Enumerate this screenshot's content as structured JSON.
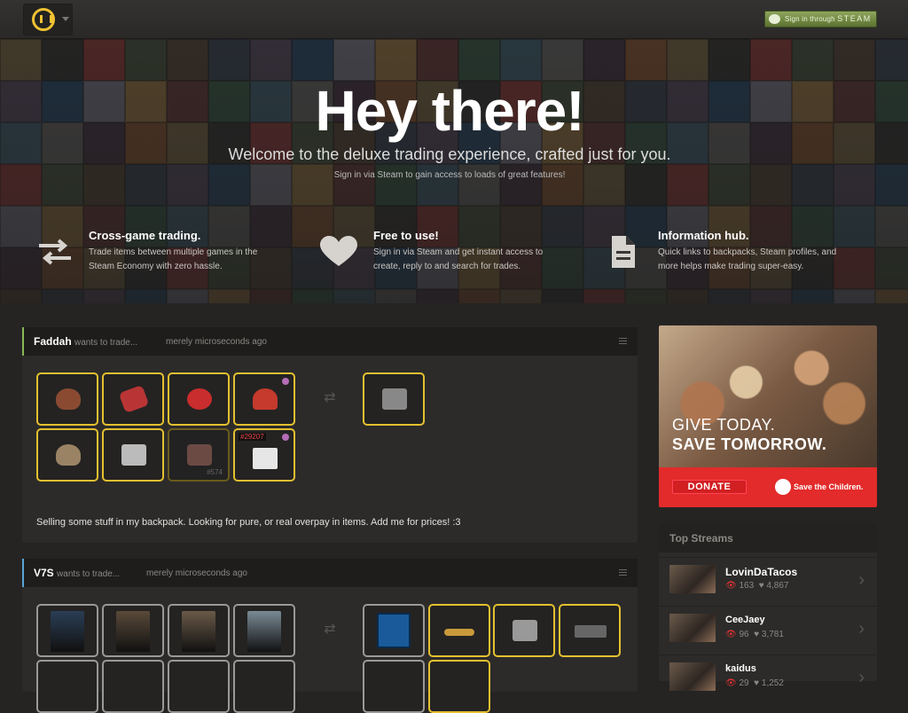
{
  "header": {
    "logo": "backpack-logo",
    "steam_signin_prefix": "Sign in through ",
    "steam_signin_word": "STEAM"
  },
  "hero": {
    "title": "Hey there!",
    "subtitle": "Welcome to the deluxe trading experience, crafted just for you.",
    "note": "Sign in via Steam to gain access to loads of great features!",
    "features": [
      {
        "icon": "exchange-arrows-icon",
        "title": "Cross-game trading.",
        "desc": "Trade items between multiple games in the Steam Economy with zero hassle."
      },
      {
        "icon": "heart-icon",
        "title": "Free to use!",
        "desc": "Sign in via Steam and get instant access to create, reply to and search for trades."
      },
      {
        "icon": "document-icon",
        "title": "Information hub.",
        "desc": "Quick links to backpacks, Steam profiles, and more helps make trading super-easy."
      }
    ]
  },
  "trades": [
    {
      "user": "Faddah",
      "wants": "wants to trade...",
      "time": "merely microseconds ago",
      "tags": [
        "#29207",
        "#574"
      ],
      "note": "Selling some stuff in my backpack. Looking for pure, or real overpay in items. Add me for prices! :3"
    },
    {
      "user": "V7S",
      "wants": "wants to trade...",
      "time": "merely microseconds ago"
    }
  ],
  "ad": {
    "line1": "GIVE TODAY.",
    "line2": "SAVE TOMORROW.",
    "donate": "DONATE",
    "org": "Save the Children."
  },
  "streams": {
    "title": "Top Streams",
    "items": [
      {
        "name": "LovinDaTacos",
        "viewers": "163",
        "followers": "4,867"
      },
      {
        "name": "CeeJaey",
        "viewers": "96",
        "followers": "3,781"
      },
      {
        "name": "kaidus",
        "viewers": "29",
        "followers": "1,252"
      }
    ]
  },
  "colors": {
    "accent_gold": "#e4c02f",
    "steam_green": "#6d8b3d",
    "donate_red": "#e22b2a"
  }
}
